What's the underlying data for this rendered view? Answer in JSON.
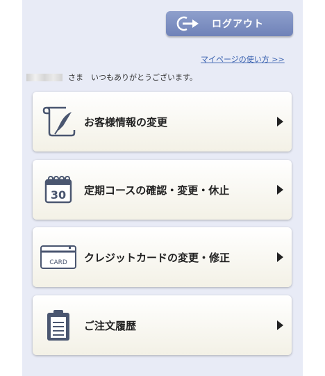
{
  "header": {
    "logout_label": "ログアウト",
    "howto_link": "マイページの使い方 >>"
  },
  "greeting": {
    "suffix": "さま　いつもありがとうございます。"
  },
  "menu": [
    {
      "label": "お客様情報の変更",
      "icon": "pen-paper-icon"
    },
    {
      "label": "定期コースの確認・変更・休止",
      "icon": "calendar-30-icon",
      "icon_text": "30"
    },
    {
      "label": "クレジットカードの変更・修正",
      "icon": "credit-card-icon",
      "icon_text": "CARD"
    },
    {
      "label": "ご注文履歴",
      "icon": "clipboard-icon"
    }
  ],
  "colors": {
    "accent": "#7a8dc0",
    "link": "#3a62b0",
    "icon": "#4a5670"
  }
}
